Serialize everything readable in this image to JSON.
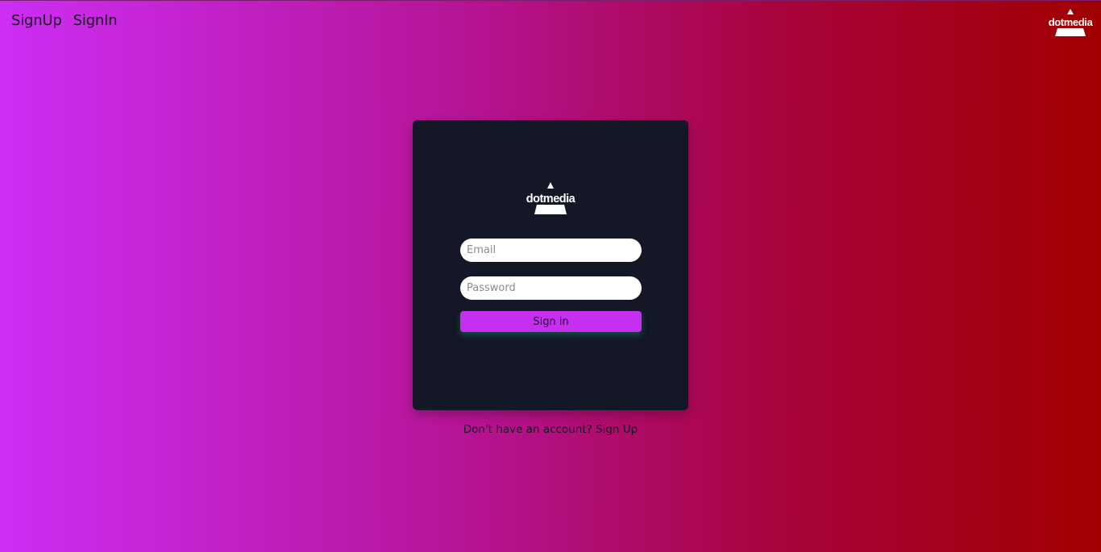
{
  "nav": {
    "signup_label": "SignUp",
    "signin_label": "SignIn"
  },
  "brand": {
    "name": "dotmedia",
    "icon": "dotmedia-logo"
  },
  "form": {
    "email_placeholder": "Email",
    "email_value": "",
    "password_placeholder": "Password",
    "password_value": "",
    "submit_label": "Sign in"
  },
  "footer": {
    "prompt": "Don't have an account?",
    "link_label": "Sign Up"
  },
  "colors": {
    "gradient_left": "#cc2ef5",
    "gradient_right": "#a00000",
    "card_background": "#141726",
    "button": "#c72ff0"
  }
}
